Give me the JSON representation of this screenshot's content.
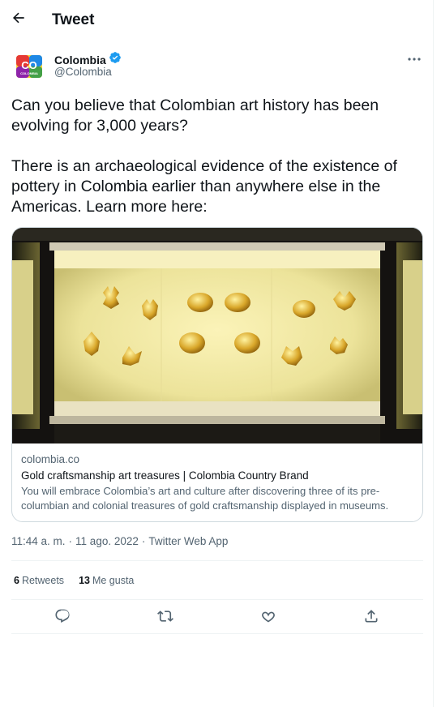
{
  "header": {
    "title": "Tweet",
    "back_icon": "arrow-left-icon"
  },
  "author": {
    "avatar_text_top": "CO",
    "avatar_text_bottom": "COLOMBIA",
    "name": "Colombia",
    "handle": "@Colombia",
    "verified_icon": "verified-badge-icon",
    "more_icon": "more-dots-icon"
  },
  "tweet": {
    "paragraph1": "Can you believe that Colombian art history has been evolving for 3,000 years?",
    "paragraph2": "There is an archaeological evidence of the existence of pottery in Colombia earlier than anywhere else in the Americas. Learn more here:"
  },
  "card": {
    "image_icon": "gold-museum-display-image",
    "domain": "colombia.co",
    "title": "Gold craftsmanship art treasures | Colombia Country Brand",
    "description": "You will embrace Colombia’s art and culture after discovering three of its pre-columbian and colonial treasures of gold craftsmanship displayed in museums."
  },
  "meta": {
    "time": "11:44 a. m.",
    "date": "11 ago. 2022",
    "source": "Twitter Web App",
    "separator": "·"
  },
  "stats": {
    "retweets_count": "6",
    "retweets_label": "Retweets",
    "likes_count": "13",
    "likes_label": "Me gusta"
  },
  "actions": {
    "reply_icon": "reply-icon",
    "retweet_icon": "retweet-icon",
    "like_icon": "heart-icon",
    "share_icon": "share-icon"
  },
  "colors": {
    "accent": "#1d9bf0",
    "text": "#0f1419",
    "secondary": "#536471",
    "border": "#eff3f4"
  }
}
